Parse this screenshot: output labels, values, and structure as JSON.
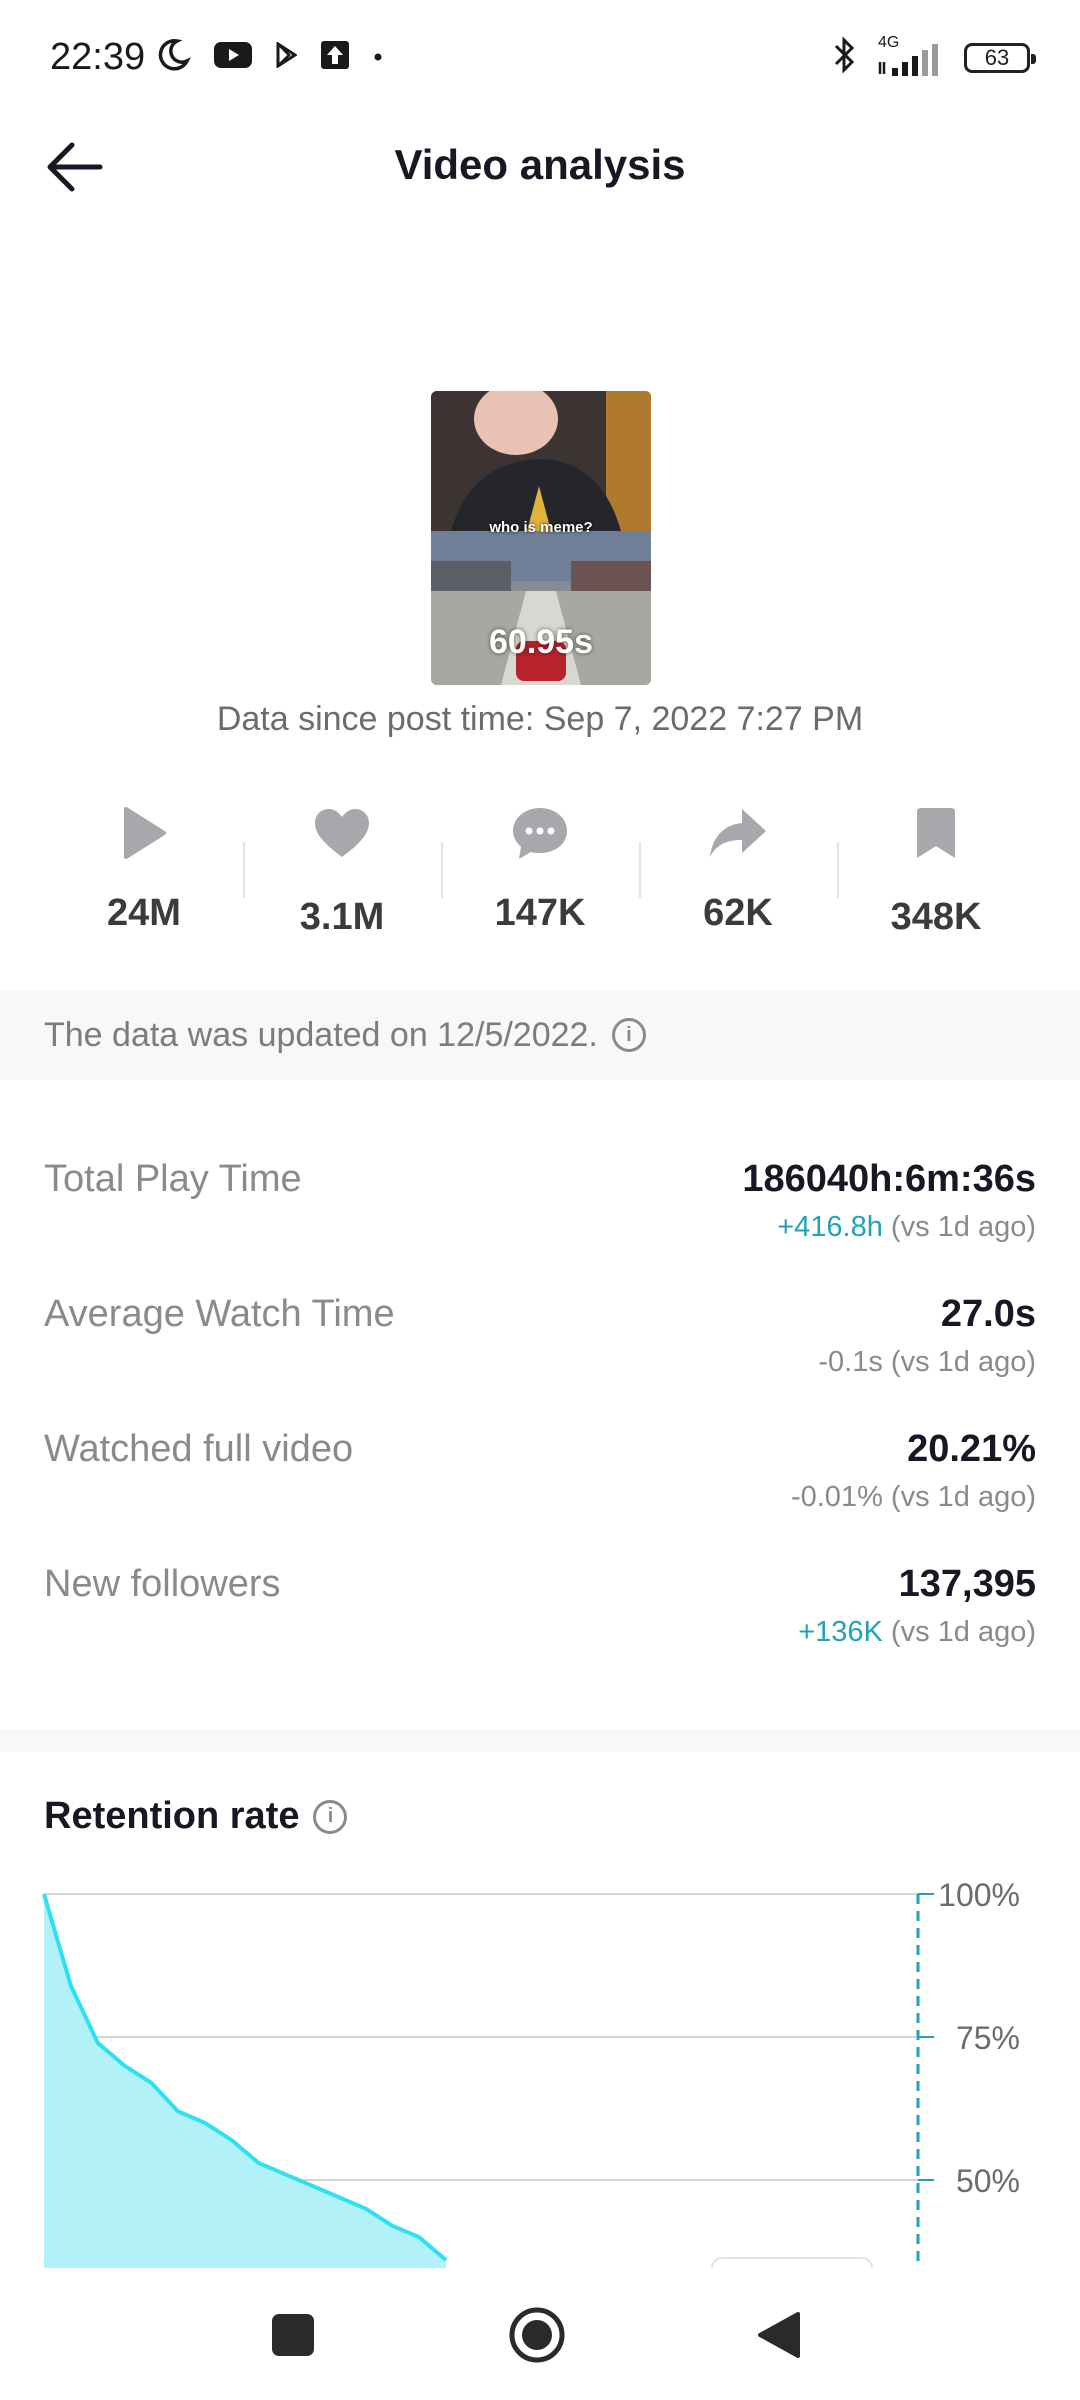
{
  "status_bar": {
    "time": "22:39",
    "network": "4G",
    "battery": "63",
    "icons_left": [
      "moon-icon",
      "youtube-icon",
      "play-store-icon",
      "upload-icon",
      "dot-icon"
    ],
    "icons_right": [
      "bluetooth-icon",
      "signal-icon",
      "battery-icon"
    ]
  },
  "header": {
    "title": "Video analysis"
  },
  "video": {
    "caption": "who is meme?",
    "duration": "60.95s",
    "post_time": "Data since post time: Sep 7, 2022 7:27 PM"
  },
  "stats": [
    {
      "icon": "play-icon",
      "value": "24M"
    },
    {
      "icon": "heart-icon",
      "value": "3.1M"
    },
    {
      "icon": "comment-icon",
      "value": "147K"
    },
    {
      "icon": "share-icon",
      "value": "62K"
    },
    {
      "icon": "bookmark-icon",
      "value": "348K"
    }
  ],
  "update_banner": {
    "text": "The data was updated on 12/5/2022."
  },
  "metrics": [
    {
      "label": "Total Play Time",
      "value": "186040h:6m:36s",
      "delta": "+416.8h",
      "compare": "(vs 1d ago)",
      "trend": "up"
    },
    {
      "label": "Average Watch Time",
      "value": "27.0s",
      "delta": "-0.1s",
      "compare": "(vs 1d ago)",
      "trend": "down"
    },
    {
      "label": "Watched full video",
      "value": "20.21%",
      "delta": "-0.01%",
      "compare": "(vs 1d ago)",
      "trend": "down"
    },
    {
      "label": "New followers",
      "value": "137,395",
      "delta": "+136K",
      "compare": "(vs 1d ago)",
      "trend": "up"
    }
  ],
  "retention": {
    "title": "Retention rate"
  },
  "colors": {
    "accent": "#20a3b7",
    "chart_line": "#2ee0f0",
    "chart_fill": "#b2f1f7",
    "text_primary": "#161823",
    "text_secondary": "#8a8a8e"
  },
  "chart_data": {
    "type": "area",
    "title": "Retention rate",
    "ylim": [
      0,
      100
    ],
    "y_ticks": [
      "100%",
      "75%",
      "50%"
    ],
    "grid": true,
    "x": [
      0,
      0.5,
      1,
      2,
      3,
      4,
      5,
      6,
      7,
      8,
      9,
      10,
      11,
      12,
      13,
      14,
      15
    ],
    "values": [
      100,
      92,
      84,
      74,
      70,
      67,
      62,
      60,
      57,
      53,
      51,
      49,
      47,
      45,
      42,
      40,
      36
    ]
  },
  "system_nav": {
    "recents": "square-icon",
    "home": "circle-icon",
    "back": "triangle-back-icon"
  }
}
